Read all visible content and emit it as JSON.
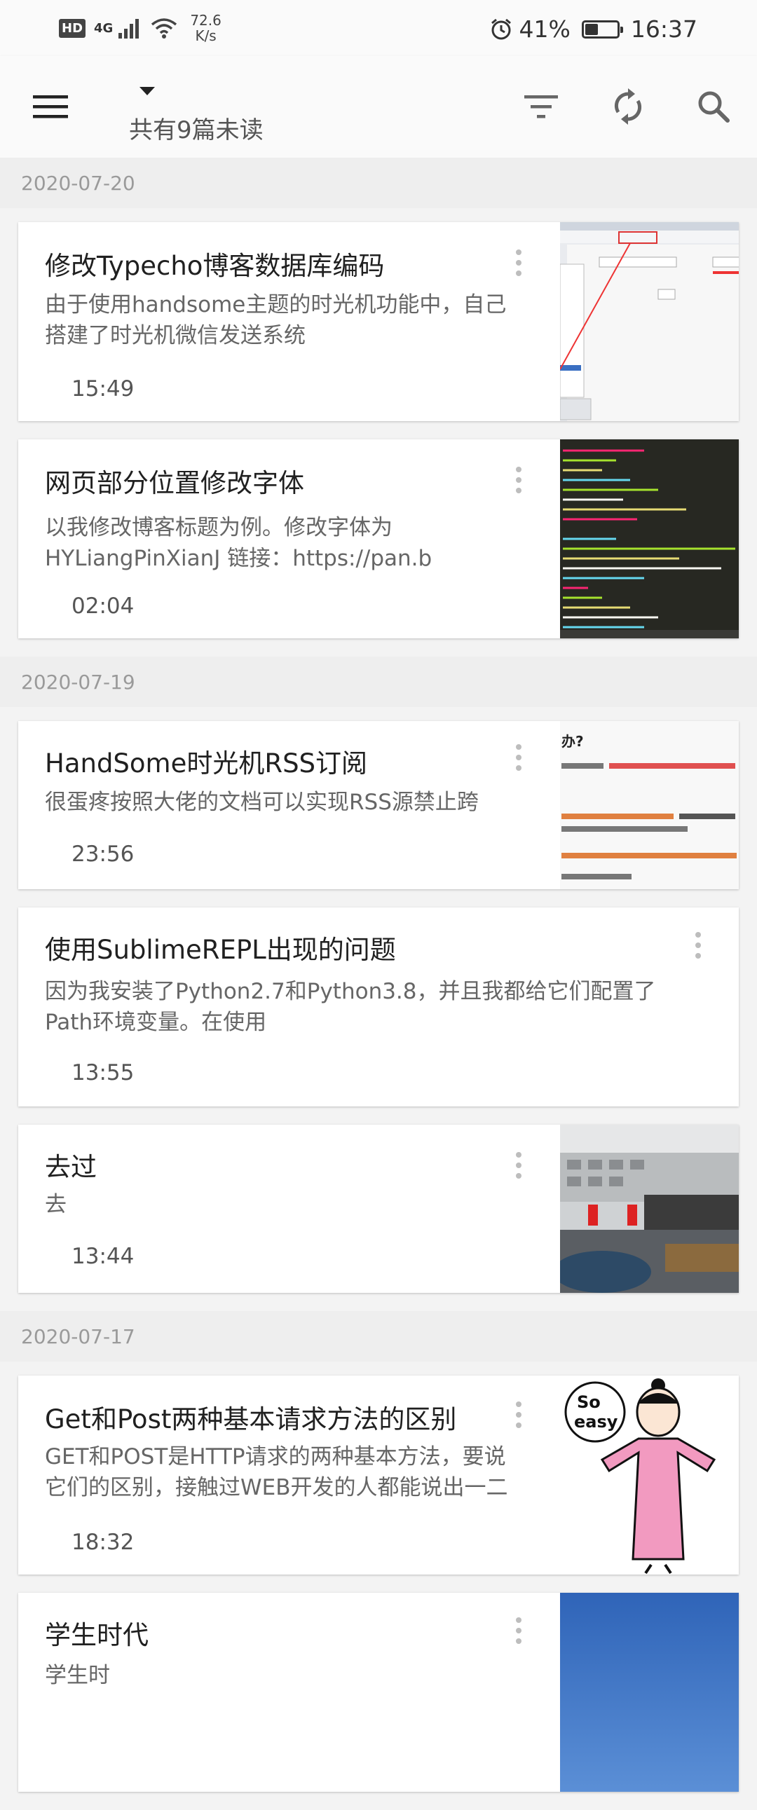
{
  "status_bar": {
    "hd_badge": "HD",
    "network_type": "4G",
    "speed_value": "72.6",
    "speed_unit": "K/s",
    "battery_text": "41%",
    "battery_level": 0.41,
    "time": "16:37"
  },
  "app_bar": {
    "subtitle": "共有9篇未读",
    "icons": [
      "menu-icon",
      "dropdown-arrow-icon",
      "filter-icon",
      "refresh-icon",
      "search-icon"
    ]
  },
  "sections": [
    {
      "date": "2020-07-20",
      "items": [
        {
          "title": "修改Typecho博客数据库编码",
          "excerpt_line1": "由于使用handsome主题的时光机功能中，自己",
          "excerpt_line2": "搭建了时光机微信发送系统",
          "time": "15:49"
        },
        {
          "title": "网页部分位置修改字体",
          "excerpt_line1": "以我修改博客标题为例。修改字体为",
          "excerpt_line2": "HYLiangPinXianJ 链接：https://pan.b",
          "time": "02:04"
        }
      ]
    },
    {
      "date": "2020-07-19",
      "items": [
        {
          "title": "HandSome时光机RSS订阅",
          "excerpt_line1": "很蛋疼按照大佬的文档可以实现RSS源禁止跨",
          "excerpt_line2": "",
          "time": "23:56"
        },
        {
          "title": "使用SublimeREPL出现的问题",
          "excerpt_line1": "因为我安装了Python2.7和Python3.8，并且我都给它们配置了",
          "excerpt_line2": "Path环境变量。在使用",
          "time": "13:55"
        },
        {
          "title": "去过",
          "excerpt_line1": "去",
          "excerpt_line2": "",
          "time": "13:44"
        }
      ]
    },
    {
      "date": "2020-07-17",
      "items": [
        {
          "title": "Get和Post两种基本请求方法的区别",
          "excerpt_line1": "GET和POST是HTTP请求的两种基本方法，要说",
          "excerpt_line2": "它们的区别，接触过WEB开发的人都能说出一二",
          "time": "18:32"
        },
        {
          "title": "学生时代",
          "excerpt_line1": "学生时",
          "excerpt_line2": "",
          "time": ""
        }
      ]
    }
  ],
  "thumbnails": {
    "rss_title_text": "办?",
    "so_easy_text_1": "So",
    "so_easy_text_2": "easy"
  }
}
